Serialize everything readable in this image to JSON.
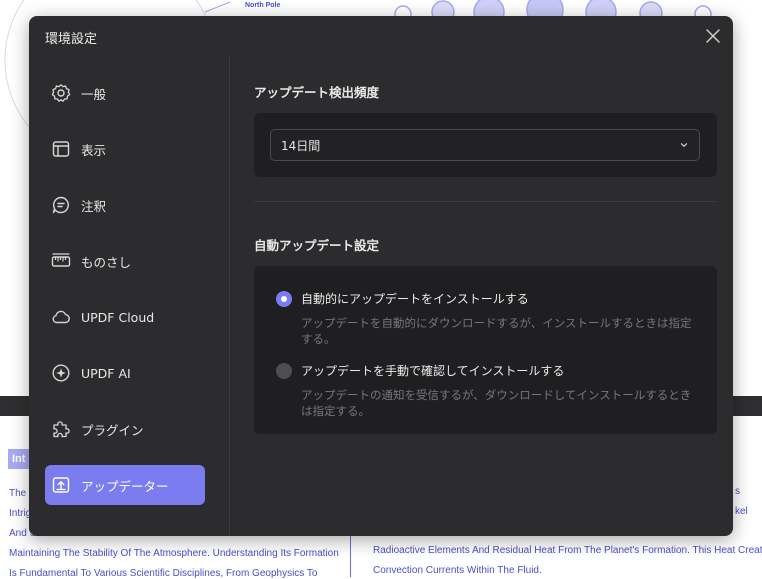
{
  "background": {
    "label_north_pole": "North Pole",
    "badge_text": "Int",
    "left_lines": [
      "The",
      "Intrig",
      "And S",
      "Maintaining The Stability Of The Atmosphere. Understanding Its Formation",
      "Is Fundamental To Various Scientific Disciplines, From Geophysics To"
    ],
    "right_lines": [
      "s",
      "kel",
      "Radioactive Elements And Residual Heat From The Planet's Formation. This Heat Creates",
      "Convection Currents Within The Fluid."
    ]
  },
  "dialog": {
    "title": "環境設定",
    "close_icon": "close-icon"
  },
  "sidebar": {
    "items": [
      {
        "label": "一般",
        "icon": "gear-icon"
      },
      {
        "label": "表示",
        "icon": "layout-icon"
      },
      {
        "label": "注釈",
        "icon": "comment-icon"
      },
      {
        "label": "ものさし",
        "icon": "ruler-icon"
      },
      {
        "label": "UPDF Cloud",
        "icon": "cloud-icon"
      },
      {
        "label": "UPDF AI",
        "icon": "ai-sparkle-icon"
      },
      {
        "label": "プラグイン",
        "icon": "puzzle-icon"
      },
      {
        "label": "アップデーター",
        "icon": "update-icon"
      }
    ],
    "active_index": 7
  },
  "content": {
    "frequency": {
      "title": "アップデート検出頻度",
      "selected": "14日間"
    },
    "auto_update": {
      "title": "自動アップデート設定",
      "options": [
        {
          "label": "自動的にアップデートをインストールする",
          "description": "アップデートを自動的にダウンロードするが、インストールするときは指定する。",
          "selected": true
        },
        {
          "label": "アップデートを手動で確認してインストールする",
          "description": "アップデートの通知を受信するが、ダウンロードしてインストールするときは指定する。",
          "selected": false
        }
      ]
    }
  },
  "colors": {
    "accent": "#7b7cf0",
    "dialog_bg": "#2c2c2e",
    "card_bg": "#1f1f21"
  }
}
